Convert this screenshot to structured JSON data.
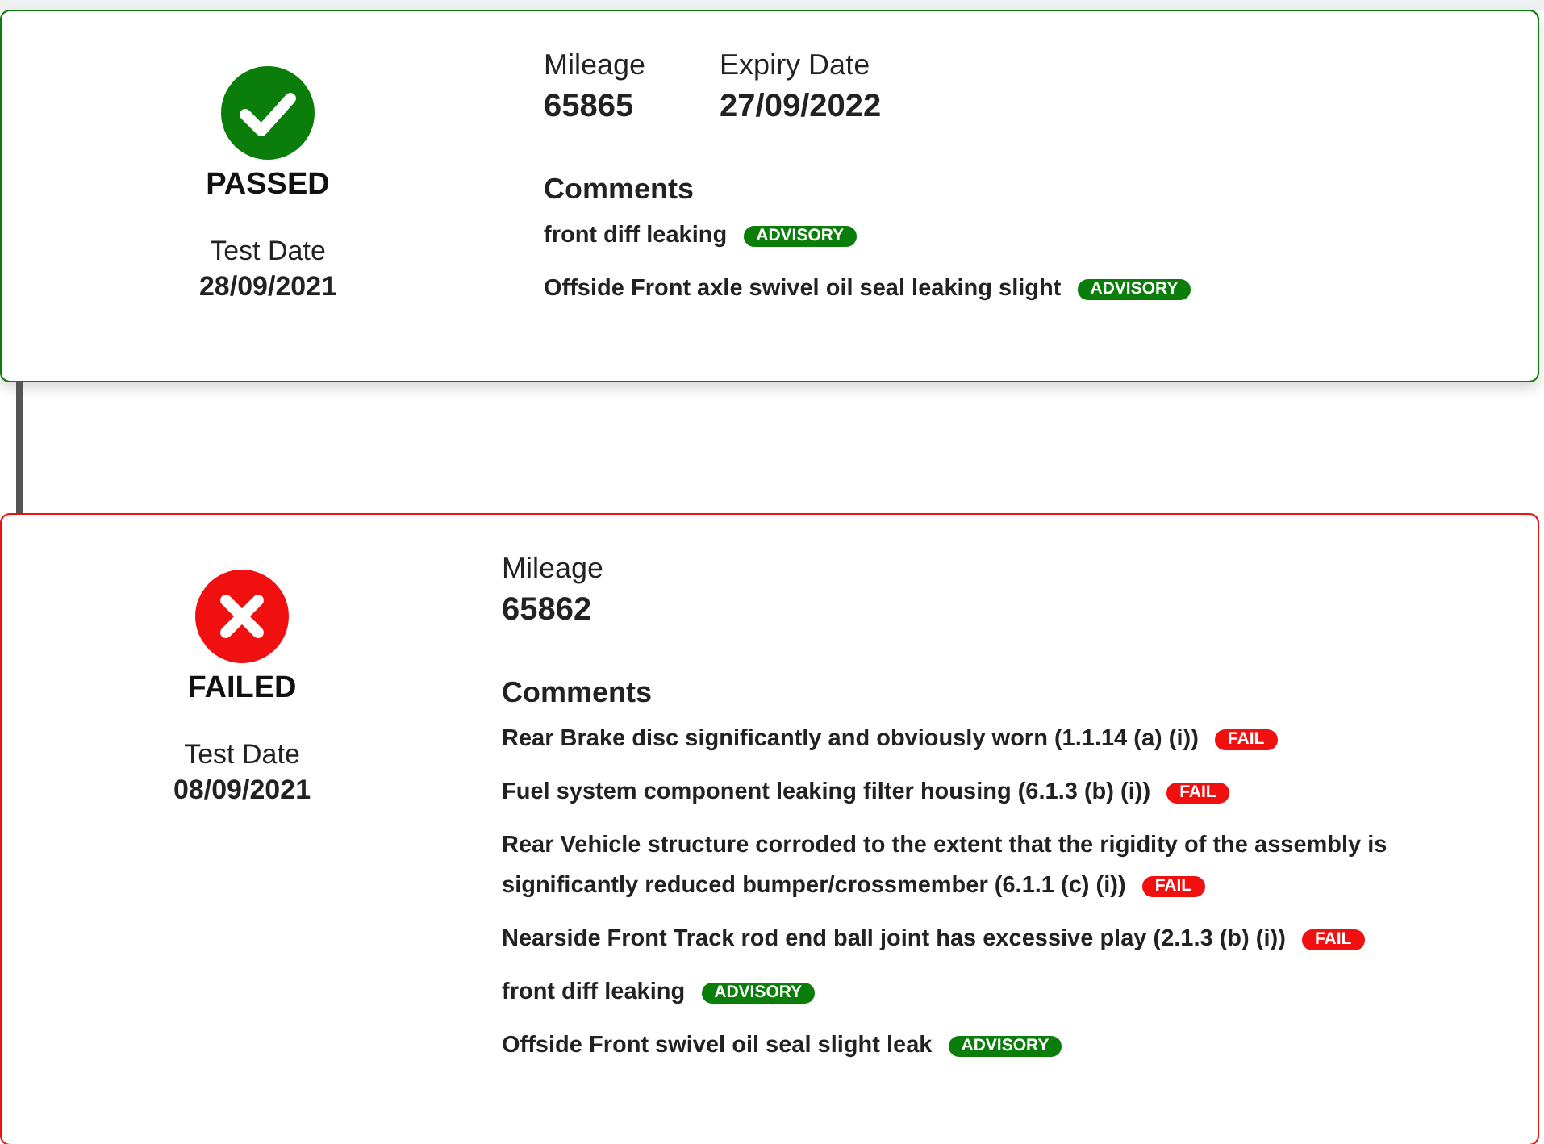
{
  "tests": [
    {
      "kind": "passed",
      "result_label": "PASSED",
      "test_date_label": "Test Date",
      "test_date": "28/09/2021",
      "fields": [
        {
          "label": "Mileage",
          "value": "65865"
        },
        {
          "label": "Expiry Date",
          "value": "27/09/2022"
        }
      ],
      "comments_heading": "Comments",
      "comments": [
        {
          "text": "front diff leaking",
          "kind": "advisory",
          "badge": "ADVISORY"
        },
        {
          "text": "Offside Front axle swivel oil seal leaking slight",
          "kind": "advisory",
          "badge": "ADVISORY"
        }
      ]
    },
    {
      "kind": "failed",
      "result_label": "FAILED",
      "test_date_label": "Test Date",
      "test_date": "08/09/2021",
      "fields": [
        {
          "label": "Mileage",
          "value": "65862"
        }
      ],
      "comments_heading": "Comments",
      "comments": [
        {
          "text": "Rear Brake disc significantly and obviously worn (1.1.14 (a) (i))",
          "kind": "fail",
          "badge": "FAIL"
        },
        {
          "text": "Fuel system component leaking filter housing (6.1.3 (b) (i))",
          "kind": "fail",
          "badge": "FAIL"
        },
        {
          "text": "Rear Vehicle structure corroded to the extent that the rigidity of the assembly is significantly reduced bumper/crossmember (6.1.1 (c) (i))",
          "kind": "fail",
          "badge": "FAIL"
        },
        {
          "text": "Nearside Front Track rod end ball joint has excessive play (2.1.3 (b) (i))",
          "kind": "fail",
          "badge": "FAIL"
        },
        {
          "text": "front diff leaking",
          "kind": "advisory",
          "badge": "ADVISORY"
        },
        {
          "text": "Offside Front swivel oil seal slight leak",
          "kind": "advisory",
          "badge": "ADVISORY"
        }
      ]
    }
  ]
}
